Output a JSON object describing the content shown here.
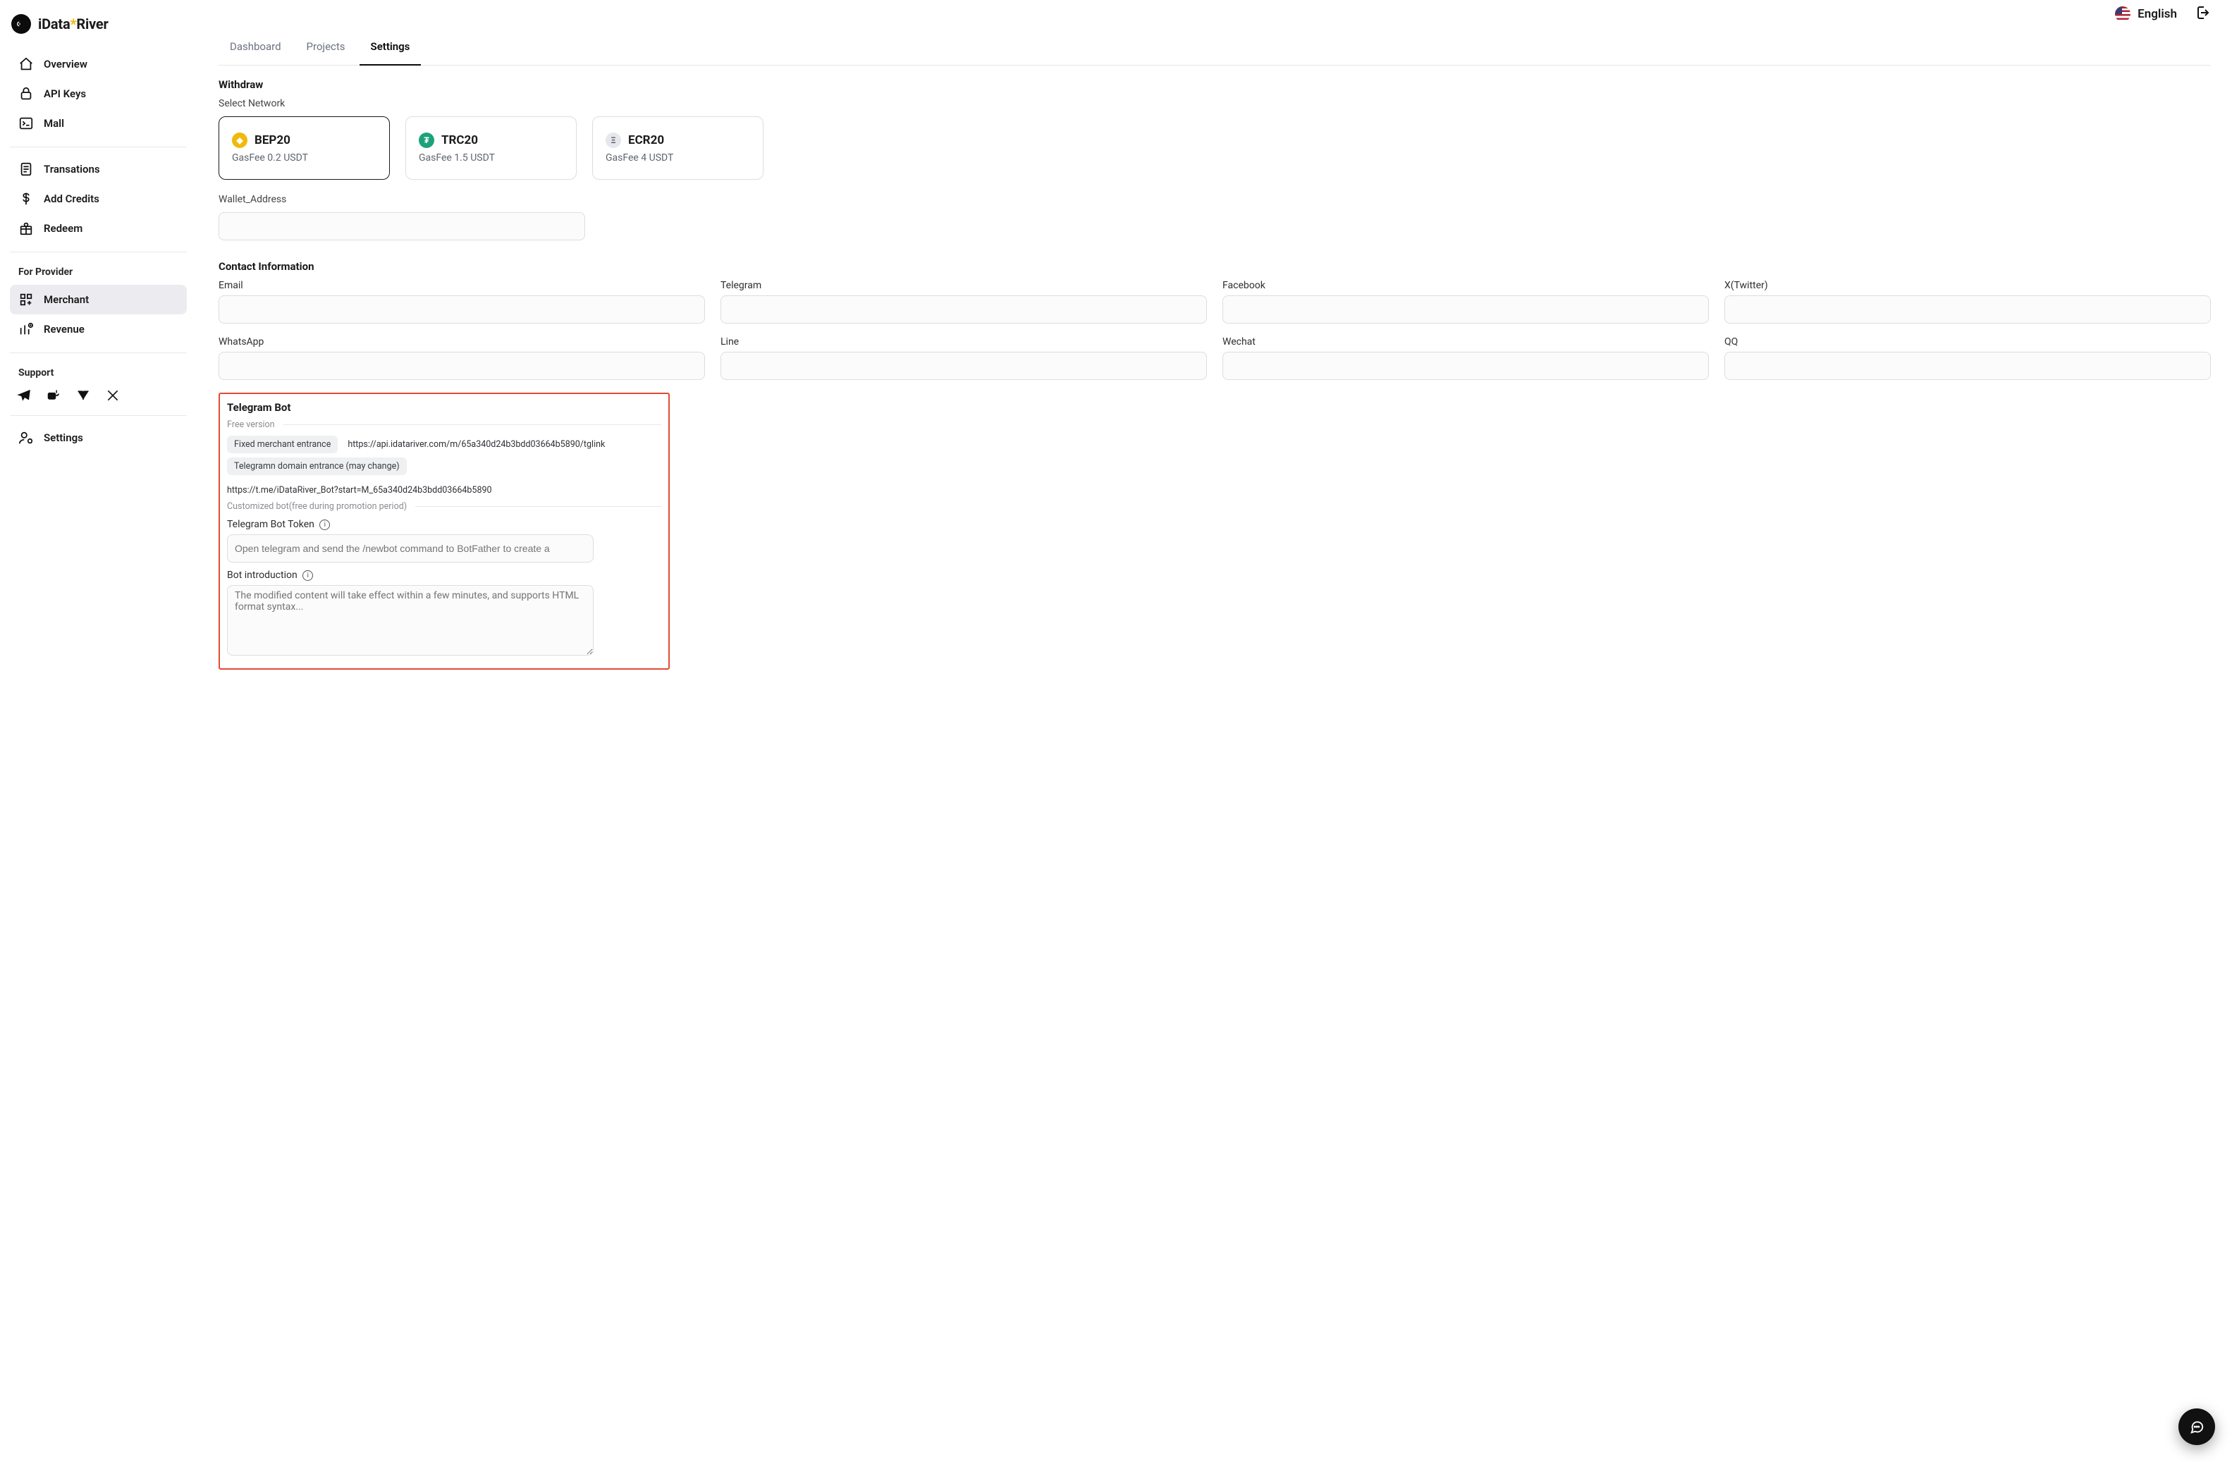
{
  "brand": {
    "name_a": "iData",
    "name_b": "River"
  },
  "lang_label": "English",
  "sidebar": {
    "items": [
      {
        "label": "Overview"
      },
      {
        "label": "API Keys"
      },
      {
        "label": "Mall"
      }
    ],
    "group2": [
      {
        "label": "Transations"
      },
      {
        "label": "Add Credits"
      },
      {
        "label": "Redeem"
      }
    ],
    "provider_label": "For Provider",
    "group3": [
      {
        "label": "Merchant"
      },
      {
        "label": "Revenue"
      }
    ],
    "support_label": "Support",
    "settings_label": "Settings"
  },
  "tabs": [
    {
      "label": "Dashboard"
    },
    {
      "label": "Projects"
    },
    {
      "label": "Settings"
    }
  ],
  "withdraw": {
    "title": "Withdraw",
    "select_network": "Select Network",
    "networks": [
      {
        "name": "BEP20",
        "fee": "GasFee 0.2 USDT"
      },
      {
        "name": "TRC20",
        "fee": "GasFee 1.5 USDT"
      },
      {
        "name": "ECR20",
        "fee": "GasFee 4 USDT"
      }
    ],
    "wallet_label": "Wallet_Address"
  },
  "contact": {
    "title": "Contact Information",
    "fields": {
      "email": "Email",
      "telegram": "Telegram",
      "facebook": "Facebook",
      "xtwitter": "X(Twitter)",
      "whatsapp": "WhatsApp",
      "line": "Line",
      "wechat": "Wechat",
      "qq": "QQ"
    }
  },
  "telegram_bot": {
    "title": "Telegram Bot",
    "free_version": "Free version",
    "row1_label": "Fixed merchant entrance",
    "row1_value": "https://api.idatariver.com/m/65a340d24b3bdd03664b5890/tglink",
    "row2_label": "Telegramn domain entrance (may change)",
    "row2_value": "https://t.me/iDataRiver_Bot?start=M_65a340d24b3bdd03664b5890",
    "custom_label": "Customized bot(free during promotion period)",
    "token_label": "Telegram Bot Token",
    "token_placeholder": "Open telegram and send the /newbot command to BotFather to create a",
    "intro_label": "Bot introduction",
    "intro_placeholder": "The modified content will take effect within a few minutes, and supports HTML format syntax..."
  }
}
